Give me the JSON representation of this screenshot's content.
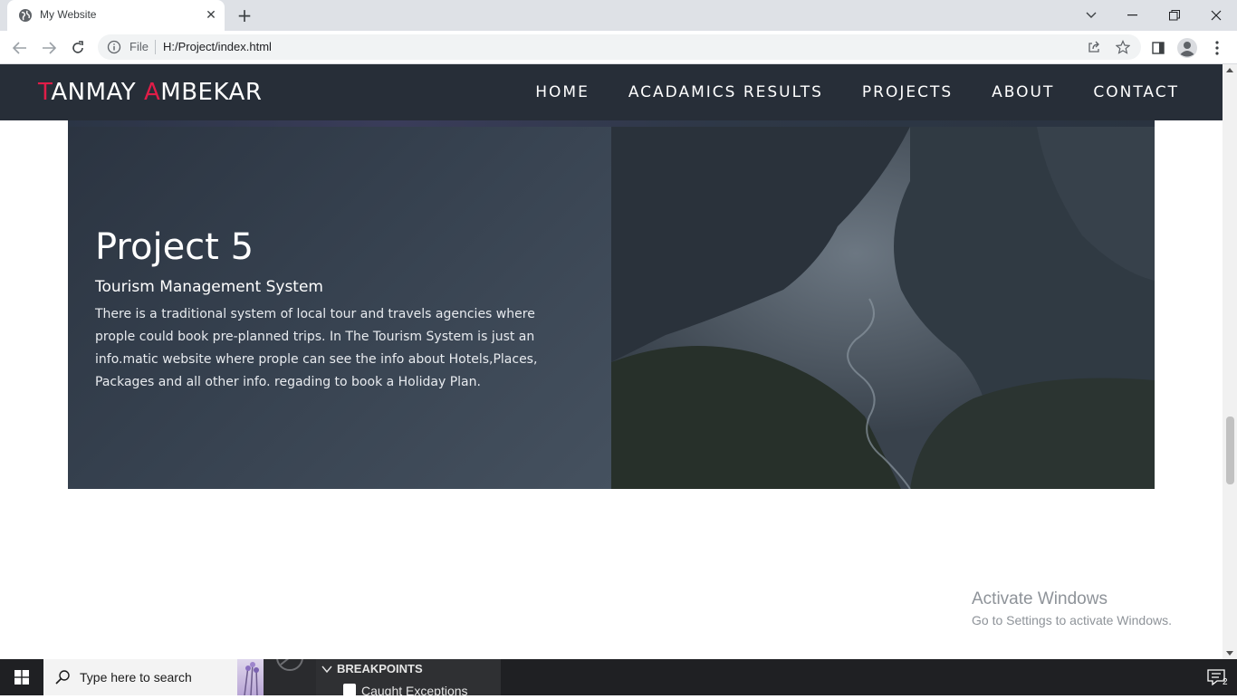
{
  "browser": {
    "tab_title": "My Website",
    "omnibox_scheme": "File",
    "url": "H:/Project/index.html"
  },
  "site": {
    "brand_first_initial": "T",
    "brand_first_rest": "ANMAY ",
    "brand_last_initial": "A",
    "brand_last_rest": "MBEKAR",
    "nav": [
      "HOME",
      "ACADAMICS RESULTS",
      "PROJECTS",
      "ABOUT",
      "CONTACT"
    ],
    "accent_color": "#e11d48",
    "nav_bg_color": "#272e38"
  },
  "project": {
    "title": "Project 5",
    "subtitle": "Tourism Management System",
    "description": "There is a traditional system of local tour and travels agencies where prople could book pre-planned trips. In The Tourism System is just an info.matic website where prople can see the info about Hotels,Places, Packages and all other info. regading to book a Holiday Plan."
  },
  "watermark": {
    "title": "Activate Windows",
    "subtitle": "Go to Settings to activate Windows."
  },
  "taskbar": {
    "search_placeholder": "Type here to search",
    "panel_title": "BREAKPOINTS",
    "panel_item": "Caught Exceptions",
    "notification_count": "2"
  },
  "scroll": {
    "position_fraction": 0.6
  }
}
